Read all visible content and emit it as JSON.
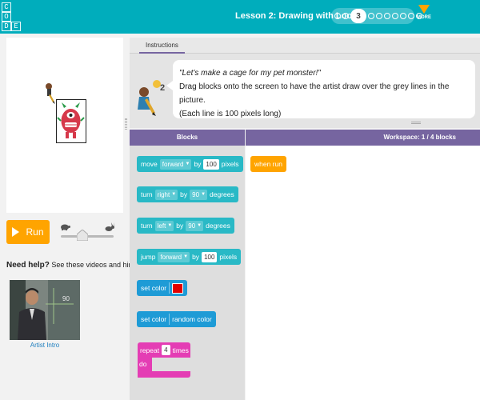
{
  "logo": {
    "letters": [
      "C",
      "O",
      "D",
      "E"
    ]
  },
  "header": {
    "lesson_title": "Lesson 2: Drawing with Loops",
    "current_puzzle": "3",
    "more_label": "MORE",
    "accent_color": "#00adbc"
  },
  "controls": {
    "run_label": "Run",
    "speed_slow_icon": "turtle-icon",
    "speed_fast_icon": "rabbit-icon"
  },
  "help": {
    "title": "Need help?",
    "subtitle": "See these videos and hints",
    "video_caption": "Artist Intro"
  },
  "instructions": {
    "tab_label": "Instructions",
    "quote": "\"Let's make a cage for my pet monster!\"",
    "line1": "Drag blocks onto the screen to have the artist draw over the grey lines in the picture.",
    "line2": "(Each line is 100 pixels long)"
  },
  "toolbox": {
    "header": "Blocks",
    "blocks": {
      "move": {
        "label": "move",
        "direction": "forward",
        "by": "by",
        "value": "100",
        "unit": "pixels"
      },
      "turn_right": {
        "label": "turn",
        "direction": "right",
        "by": "by",
        "value": "90",
        "unit": "degrees"
      },
      "turn_left": {
        "label": "turn",
        "direction": "left",
        "by": "by",
        "value": "90",
        "unit": "degrees"
      },
      "jump": {
        "label": "jump",
        "direction": "forward",
        "by": "by",
        "value": "100",
        "unit": "pixels"
      },
      "set_color": {
        "label": "set color",
        "color": "#e10000"
      },
      "set_random_color": {
        "label": "set color",
        "value": "random color"
      },
      "repeat": {
        "label": "repeat",
        "times_value": "4",
        "times_label": "times",
        "do_label": "do"
      }
    }
  },
  "workspace": {
    "header": "Workspace: 1 / 4 blocks",
    "when_run_label": "when run"
  },
  "colors": {
    "purple_header": "#7665a0",
    "motion_block": "#29b9c6",
    "color_block": "#1e9bd6",
    "loop_block": "#e43db4",
    "event_block": "#ffa400"
  }
}
